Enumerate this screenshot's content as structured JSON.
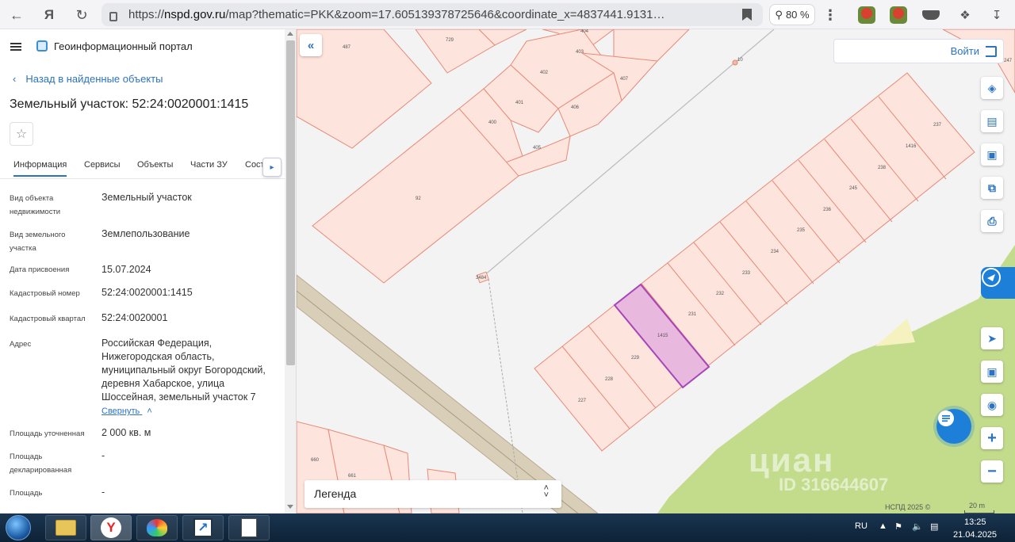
{
  "browser": {
    "url_prefix": "https://",
    "url_host": "nspd.gov.ru",
    "url_rest": "/map?thematic=PKK&zoom=17.605139378725646&coordinate_x=4837441.9131…",
    "zoom": "80 %"
  },
  "panel": {
    "portal_title": "Геоинформационный портал",
    "back_link": "Назад в найденные объекты",
    "title": "Земельный участок: 52:24:0020001:1415",
    "tabs": [
      "Информация",
      "Сервисы",
      "Объекты",
      "Части ЗУ",
      "Сост"
    ],
    "fields": [
      {
        "label": "Вид объекта недвижимости",
        "value": "Земельный участок"
      },
      {
        "label": "Вид земельного участка",
        "value": "Землепользование"
      },
      {
        "label": "Дата присвоения",
        "value": "15.07.2024"
      },
      {
        "label": "Кадастровый номер",
        "value": "52:24:0020001:1415"
      },
      {
        "label": "Кадастровый квартал",
        "value": "52:24:0020001"
      },
      {
        "label": "Адрес",
        "value": "Российская Федерация, Нижегородская область, муниципальный округ Богородский, деревня Хабарское, улица Шоссейная, земельный участок 7"
      },
      {
        "label": "Площадь уточненная",
        "value": "2 000 кв. м"
      },
      {
        "label": "Площадь декларированная",
        "value": "-"
      },
      {
        "label": "Площадь",
        "value": "-"
      }
    ],
    "collapse_link": "Свернуть"
  },
  "map": {
    "login": "Войти",
    "legend": "Легенда",
    "copyright": "НСПД 2025 ©",
    "scale": "20 m",
    "watermark_brand": "циан",
    "watermark_id": "ID 316644607",
    "parcels": [
      {
        "label": "487"
      },
      {
        "label": "729"
      },
      {
        "label": "404"
      },
      {
        "label": "403"
      },
      {
        "label": "402"
      },
      {
        "label": "407"
      },
      {
        "label": "401"
      },
      {
        "label": "406"
      },
      {
        "label": "400"
      },
      {
        "label": "405"
      },
      {
        "label": "92"
      },
      {
        "label": "237"
      },
      {
        "label": "1416"
      },
      {
        "label": "238"
      },
      {
        "label": "245"
      },
      {
        "label": "236"
      },
      {
        "label": "235"
      },
      {
        "label": "234"
      },
      {
        "label": "233"
      },
      {
        "label": "232"
      },
      {
        "label": "231"
      },
      {
        "label": "1415"
      },
      {
        "label": "229"
      },
      {
        "label": "228"
      },
      {
        "label": "227"
      },
      {
        "label": "3484"
      },
      {
        "label": "660"
      },
      {
        "label": "661"
      },
      {
        "label": "247"
      },
      {
        "label": "10"
      }
    ]
  },
  "taskbar": {
    "lang": "RU",
    "time": "13:25",
    "date": "21.04.2025"
  }
}
